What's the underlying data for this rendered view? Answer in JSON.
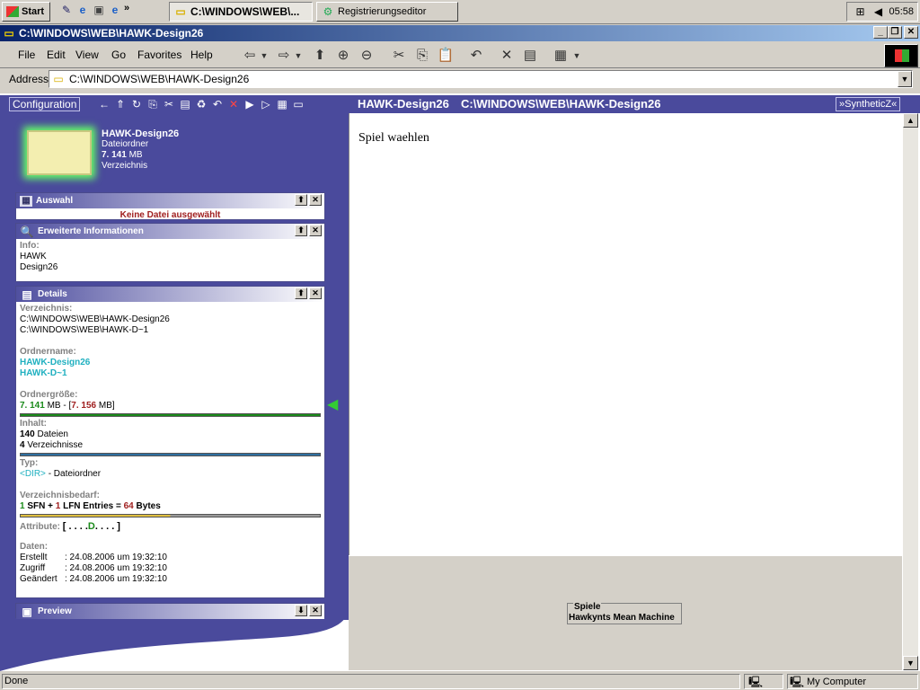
{
  "taskbar": {
    "start": "Start",
    "task1": "C:\\WINDOWS\\WEB\\...",
    "task2": "Registrierungseditor",
    "clock": "05:58",
    "chevron": "»"
  },
  "window": {
    "title": "C:\\WINDOWS\\WEB\\HAWK-Design26"
  },
  "menu": {
    "file": "File",
    "edit": "Edit",
    "view": "View",
    "go": "Go",
    "favorites": "Favorites",
    "help": "Help"
  },
  "address": {
    "label": "Address",
    "value": "C:\\WINDOWS\\WEB\\HAWK-Design26"
  },
  "toolbar2": {
    "config": "Configuration",
    "folder": "HAWK-Design26",
    "path": "C:\\WINDOWS\\WEB\\HAWK-Design26",
    "brand": "»SyntheticZ«"
  },
  "header": {
    "name": "HAWK-Design26",
    "type": "Dateiordner",
    "size_num": "7. 141",
    "size_unit": "MB",
    "kind": "Verzeichnis"
  },
  "auswahl": {
    "title": "Auswahl",
    "message": "Keine Datei ausgewählt"
  },
  "erweitert": {
    "title": "Erweiterte Informationen",
    "label": "Info:",
    "line1": "HAWK",
    "line2": "Design26"
  },
  "details": {
    "title": "Details",
    "dir_label": "Verzeichnis:",
    "dir1": "C:\\WINDOWS\\WEB\\HAWK-Design26",
    "dir2": "C:\\WINDOWS\\WEB\\HAWK-D~1",
    "name_label": "Ordnername:",
    "name1": "HAWK-Design26",
    "name2": "HAWK-D~1",
    "size_label": "Ordnergröße:",
    "size1": "7. 141",
    "size1_unit": "MB",
    "size_sep": "- [",
    "size2": "7. 156",
    "size2_unit": "MB]",
    "content_label": "Inhalt:",
    "files_n": "140",
    "files": "Dateien",
    "dirs_n": "4",
    "dirs": "Verzeichnisse",
    "type_label": "Typ:",
    "type_dir": "<DIR>",
    "type_text": "- Dateiordner",
    "req_label": "Verzeichnisbedarf:",
    "req_a": "1",
    "req_b": "SFN +",
    "req_c": "1",
    "req_d": "LFN Entries =",
    "req_e": "64",
    "req_f": "Bytes",
    "attr_label": "Attribute:",
    "attr_open": "[ . . . .",
    "attr_d": "D",
    "attr_close": ". . . . ]",
    "dates_label": "Daten:",
    "created_l": "Erstellt",
    "created_v": ": 24.08.2006 um 19:32:10",
    "access_l": "Zugriff",
    "access_v": ": 24.08.2006 um 19:32:10",
    "changed_l": "Geändert",
    "changed_v": ": 24.08.2006 um 19:32:10"
  },
  "preview": {
    "title": "Preview"
  },
  "content": {
    "heading": "Spiel waehlen",
    "games_label": "Spiele",
    "game1": "Hawkynts Mean Machine"
  },
  "status": {
    "left": "Done",
    "zone": "My Computer"
  },
  "colors": {
    "accent": "#4a4a9c",
    "green": "#1a8a1a",
    "red": "#a02020",
    "cyan": "#20b0c0"
  }
}
